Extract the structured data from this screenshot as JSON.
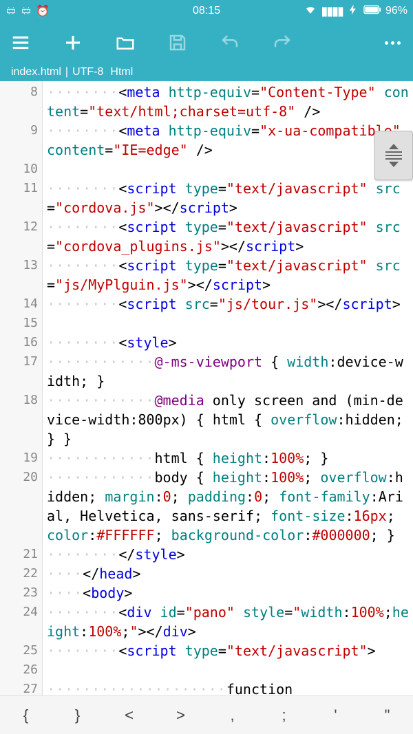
{
  "status": {
    "time": "08:15",
    "battery_pct": "96%"
  },
  "file": {
    "name": "index.html",
    "encoding": "UTF-8",
    "lang": "Html"
  },
  "lines": [
    {
      "n": "8",
      "segs": [
        {
          "cls": "ws",
          "t": "········"
        },
        {
          "cls": "t-pun",
          "t": "<"
        },
        {
          "cls": "t-tag",
          "t": "meta"
        },
        {
          "cls": "t-txt",
          "t": " "
        },
        {
          "cls": "t-attr",
          "t": "http-equiv"
        },
        {
          "cls": "t-pun",
          "t": "="
        },
        {
          "cls": "t-str",
          "t": "\"Content-Type\""
        },
        {
          "cls": "t-txt",
          "t": " "
        },
        {
          "cls": "t-attr",
          "t": "content"
        },
        {
          "cls": "t-pun",
          "t": "="
        },
        {
          "cls": "t-str",
          "t": "\"text/html;charset=utf-8\""
        },
        {
          "cls": "t-txt",
          "t": " "
        },
        {
          "cls": "t-pun",
          "t": "/>"
        }
      ]
    },
    {
      "n": "9",
      "segs": [
        {
          "cls": "ws",
          "t": "········"
        },
        {
          "cls": "t-pun",
          "t": "<"
        },
        {
          "cls": "t-tag",
          "t": "meta"
        },
        {
          "cls": "t-txt",
          "t": " "
        },
        {
          "cls": "t-attr",
          "t": "http-equiv"
        },
        {
          "cls": "t-pun",
          "t": "="
        },
        {
          "cls": "t-str",
          "t": "\"x-ua-compatible\""
        },
        {
          "cls": "t-txt",
          "t": " "
        },
        {
          "cls": "t-attr",
          "t": "content"
        },
        {
          "cls": "t-pun",
          "t": "="
        },
        {
          "cls": "t-str",
          "t": "\"IE=edge\""
        },
        {
          "cls": "t-txt",
          "t": " "
        },
        {
          "cls": "t-pun",
          "t": "/>"
        }
      ]
    },
    {
      "n": "10",
      "segs": []
    },
    {
      "n": "11",
      "segs": [
        {
          "cls": "ws",
          "t": "········"
        },
        {
          "cls": "t-pun",
          "t": "<"
        },
        {
          "cls": "t-tag",
          "t": "script"
        },
        {
          "cls": "t-txt",
          "t": " "
        },
        {
          "cls": "t-attr",
          "t": "type"
        },
        {
          "cls": "t-pun",
          "t": "="
        },
        {
          "cls": "t-str",
          "t": "\"text/javascript\""
        },
        {
          "cls": "t-txt",
          "t": " "
        },
        {
          "cls": "t-attr",
          "t": "src"
        },
        {
          "cls": "t-pun",
          "t": "="
        },
        {
          "cls": "t-str",
          "t": "\"cordova.js\""
        },
        {
          "cls": "t-pun",
          "t": "></"
        },
        {
          "cls": "t-tag",
          "t": "script"
        },
        {
          "cls": "t-pun",
          "t": ">"
        }
      ]
    },
    {
      "n": "12",
      "segs": [
        {
          "cls": "ws",
          "t": "········"
        },
        {
          "cls": "t-pun",
          "t": "<"
        },
        {
          "cls": "t-tag",
          "t": "script"
        },
        {
          "cls": "t-txt",
          "t": " "
        },
        {
          "cls": "t-attr",
          "t": "type"
        },
        {
          "cls": "t-pun",
          "t": "="
        },
        {
          "cls": "t-str",
          "t": "\"text/javascript\""
        },
        {
          "cls": "t-txt",
          "t": " "
        },
        {
          "cls": "t-attr",
          "t": "src"
        },
        {
          "cls": "t-pun",
          "t": "="
        },
        {
          "cls": "t-str",
          "t": "\"cordova_plugins.js\""
        },
        {
          "cls": "t-pun",
          "t": "></"
        },
        {
          "cls": "t-tag",
          "t": "script"
        },
        {
          "cls": "t-pun",
          "t": ">"
        }
      ]
    },
    {
      "n": "13",
      "segs": [
        {
          "cls": "ws",
          "t": "········"
        },
        {
          "cls": "t-pun",
          "t": "<"
        },
        {
          "cls": "t-tag",
          "t": "script"
        },
        {
          "cls": "t-txt",
          "t": " "
        },
        {
          "cls": "t-attr",
          "t": "type"
        },
        {
          "cls": "t-pun",
          "t": "="
        },
        {
          "cls": "t-str",
          "t": "\"text/javascript\""
        },
        {
          "cls": "t-txt",
          "t": " "
        },
        {
          "cls": "t-attr",
          "t": "src"
        },
        {
          "cls": "t-pun",
          "t": "="
        },
        {
          "cls": "t-str",
          "t": "\"js/MyPlguin.js\""
        },
        {
          "cls": "t-pun",
          "t": "></"
        },
        {
          "cls": "t-tag",
          "t": "script"
        },
        {
          "cls": "t-pun",
          "t": ">"
        }
      ]
    },
    {
      "n": "14",
      "segs": [
        {
          "cls": "ws",
          "t": "········"
        },
        {
          "cls": "t-pun",
          "t": "<"
        },
        {
          "cls": "t-tag",
          "t": "script"
        },
        {
          "cls": "t-txt",
          "t": " "
        },
        {
          "cls": "t-attr",
          "t": "src"
        },
        {
          "cls": "t-pun",
          "t": "="
        },
        {
          "cls": "t-str",
          "t": "\"js/tour.js\""
        },
        {
          "cls": "t-pun",
          "t": "></"
        },
        {
          "cls": "t-tag",
          "t": "script"
        },
        {
          "cls": "t-pun",
          "t": ">"
        }
      ]
    },
    {
      "n": "15",
      "segs": []
    },
    {
      "n": "16",
      "segs": [
        {
          "cls": "ws",
          "t": "········"
        },
        {
          "cls": "t-pun",
          "t": "<"
        },
        {
          "cls": "t-tag",
          "t": "style"
        },
        {
          "cls": "t-pun",
          "t": ">"
        }
      ]
    },
    {
      "n": "17",
      "segs": [
        {
          "cls": "ws",
          "t": "············"
        },
        {
          "cls": "t-atrule",
          "t": "@-ms-viewport"
        },
        {
          "cls": "t-txt",
          "t": " { "
        },
        {
          "cls": "t-prop",
          "t": "width"
        },
        {
          "cls": "t-pun",
          "t": ":"
        },
        {
          "cls": "t-val",
          "t": "device-width"
        },
        {
          "cls": "t-pun",
          "t": ";"
        },
        {
          "cls": "t-txt",
          "t": " }"
        }
      ]
    },
    {
      "n": "18",
      "segs": [
        {
          "cls": "ws",
          "t": "············"
        },
        {
          "cls": "t-atrule",
          "t": "@media"
        },
        {
          "cls": "t-txt",
          "t": " only screen and (min-device-width:800px) { html { "
        },
        {
          "cls": "t-prop",
          "t": "overflow"
        },
        {
          "cls": "t-pun",
          "t": ":"
        },
        {
          "cls": "t-val",
          "t": "hidden"
        },
        {
          "cls": "t-pun",
          "t": ";"
        },
        {
          "cls": "t-txt",
          "t": " } }"
        }
      ]
    },
    {
      "n": "19",
      "segs": [
        {
          "cls": "ws",
          "t": "············"
        },
        {
          "cls": "t-txt",
          "t": "html { "
        },
        {
          "cls": "t-prop",
          "t": "height"
        },
        {
          "cls": "t-pun",
          "t": ":"
        },
        {
          "cls": "t-num",
          "t": "100%"
        },
        {
          "cls": "t-pun",
          "t": ";"
        },
        {
          "cls": "t-txt",
          "t": " }"
        }
      ]
    },
    {
      "n": "20",
      "segs": [
        {
          "cls": "ws",
          "t": "············"
        },
        {
          "cls": "t-txt",
          "t": "body { "
        },
        {
          "cls": "t-prop",
          "t": "height"
        },
        {
          "cls": "t-pun",
          "t": ":"
        },
        {
          "cls": "t-num",
          "t": "100%"
        },
        {
          "cls": "t-pun",
          "t": ";"
        },
        {
          "cls": "t-txt",
          "t": " "
        },
        {
          "cls": "t-prop",
          "t": "overflow"
        },
        {
          "cls": "t-pun",
          "t": ":"
        },
        {
          "cls": "t-val",
          "t": "hidden"
        },
        {
          "cls": "t-pun",
          "t": ";"
        },
        {
          "cls": "t-txt",
          "t": " "
        },
        {
          "cls": "t-prop",
          "t": "margin"
        },
        {
          "cls": "t-pun",
          "t": ":"
        },
        {
          "cls": "t-num",
          "t": "0"
        },
        {
          "cls": "t-pun",
          "t": ";"
        },
        {
          "cls": "t-txt",
          "t": " "
        },
        {
          "cls": "t-prop",
          "t": "padding"
        },
        {
          "cls": "t-pun",
          "t": ":"
        },
        {
          "cls": "t-num",
          "t": "0"
        },
        {
          "cls": "t-pun",
          "t": ";"
        },
        {
          "cls": "t-txt",
          "t": " "
        },
        {
          "cls": "t-prop",
          "t": "font-family"
        },
        {
          "cls": "t-pun",
          "t": ":"
        },
        {
          "cls": "t-val",
          "t": "Arial, Helvetica, sans-serif"
        },
        {
          "cls": "t-pun",
          "t": ";"
        },
        {
          "cls": "t-txt",
          "t": " "
        },
        {
          "cls": "t-prop",
          "t": "font-size"
        },
        {
          "cls": "t-pun",
          "t": ":"
        },
        {
          "cls": "t-num",
          "t": "16px"
        },
        {
          "cls": "t-pun",
          "t": ";"
        },
        {
          "cls": "t-txt",
          "t": " "
        },
        {
          "cls": "t-prop",
          "t": "color"
        },
        {
          "cls": "t-pun",
          "t": ":"
        },
        {
          "cls": "t-color",
          "t": "#FFFFFF"
        },
        {
          "cls": "t-pun",
          "t": ";"
        },
        {
          "cls": "t-txt",
          "t": " "
        },
        {
          "cls": "t-prop",
          "t": "background-color"
        },
        {
          "cls": "t-pun",
          "t": ":"
        },
        {
          "cls": "t-color",
          "t": "#000000"
        },
        {
          "cls": "t-pun",
          "t": ";"
        },
        {
          "cls": "t-txt",
          "t": " }"
        }
      ]
    },
    {
      "n": "21",
      "segs": [
        {
          "cls": "ws",
          "t": "········"
        },
        {
          "cls": "t-pun",
          "t": "</"
        },
        {
          "cls": "t-tag",
          "t": "style"
        },
        {
          "cls": "t-pun",
          "t": ">"
        }
      ]
    },
    {
      "n": "22",
      "segs": [
        {
          "cls": "ws",
          "t": "····"
        },
        {
          "cls": "t-pun",
          "t": "</"
        },
        {
          "cls": "t-tag",
          "t": "head"
        },
        {
          "cls": "t-pun",
          "t": ">"
        }
      ]
    },
    {
      "n": "23",
      "segs": [
        {
          "cls": "ws",
          "t": "····"
        },
        {
          "cls": "t-pun",
          "t": "<"
        },
        {
          "cls": "t-tag",
          "t": "body"
        },
        {
          "cls": "t-pun",
          "t": ">"
        }
      ]
    },
    {
      "n": "24",
      "segs": [
        {
          "cls": "ws",
          "t": "········"
        },
        {
          "cls": "t-pun",
          "t": "<"
        },
        {
          "cls": "t-tag",
          "t": "div"
        },
        {
          "cls": "t-txt",
          "t": " "
        },
        {
          "cls": "t-attr",
          "t": "id"
        },
        {
          "cls": "t-pun",
          "t": "="
        },
        {
          "cls": "t-str",
          "t": "\"pano\""
        },
        {
          "cls": "t-txt",
          "t": " "
        },
        {
          "cls": "t-attr",
          "t": "style"
        },
        {
          "cls": "t-pun",
          "t": "="
        },
        {
          "cls": "t-str",
          "t": "\""
        },
        {
          "cls": "t-prop",
          "t": "width"
        },
        {
          "cls": "t-pun",
          "t": ":"
        },
        {
          "cls": "t-num",
          "t": "100%"
        },
        {
          "cls": "t-pun",
          "t": ";"
        },
        {
          "cls": "t-prop",
          "t": "height"
        },
        {
          "cls": "t-pun",
          "t": ":"
        },
        {
          "cls": "t-num",
          "t": "100%"
        },
        {
          "cls": "t-pun",
          "t": ";"
        },
        {
          "cls": "t-str",
          "t": "\""
        },
        {
          "cls": "t-pun",
          "t": "></"
        },
        {
          "cls": "t-tag",
          "t": "div"
        },
        {
          "cls": "t-pun",
          "t": ">"
        }
      ]
    },
    {
      "n": "25",
      "segs": [
        {
          "cls": "ws",
          "t": "········"
        },
        {
          "cls": "t-pun",
          "t": "<"
        },
        {
          "cls": "t-tag",
          "t": "script"
        },
        {
          "cls": "t-txt",
          "t": " "
        },
        {
          "cls": "t-attr",
          "t": "type"
        },
        {
          "cls": "t-pun",
          "t": "="
        },
        {
          "cls": "t-str",
          "t": "\"text/javascript\""
        },
        {
          "cls": "t-pun",
          "t": ">"
        }
      ]
    },
    {
      "n": "26",
      "segs": []
    },
    {
      "n": "27",
      "segs": [
        {
          "cls": "ws",
          "t": "····················"
        },
        {
          "cls": "t-txt",
          "t": "function"
        }
      ]
    }
  ],
  "symbols": [
    "{",
    "}",
    "<",
    ">",
    ",",
    ";",
    "'",
    "\""
  ]
}
